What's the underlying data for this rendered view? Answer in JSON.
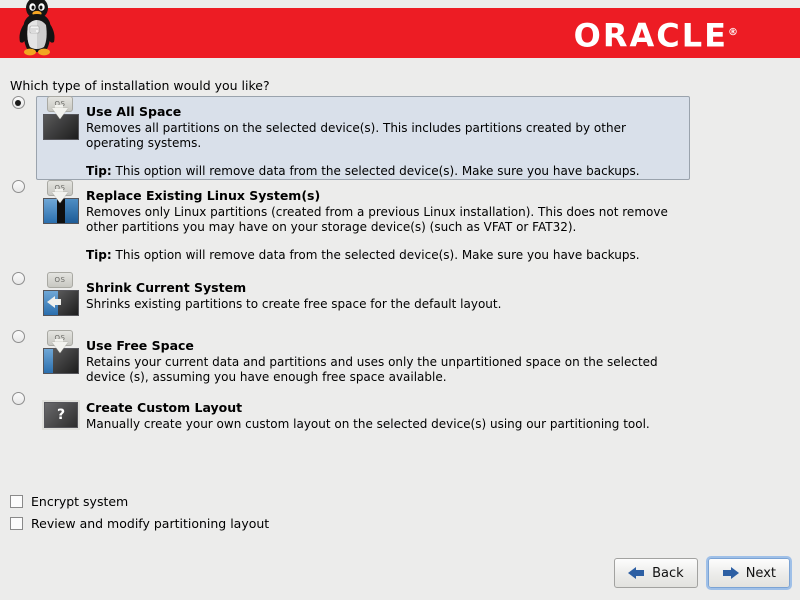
{
  "header": {
    "brand": "ORACLE",
    "registered_mark": "®",
    "logo_icon": "tux-penguin-icon",
    "background_color": "#ed1c24"
  },
  "main": {
    "question": "Which type of installation would you like?",
    "options": [
      {
        "id": "use-all-space",
        "title": "Use All Space",
        "description": "Removes all partitions on the selected device(s).  This includes partitions created by other operating systems.",
        "tip_label": "Tip:",
        "tip": " This option will remove data from the selected device(s).  Make sure you have backups.",
        "selected": true,
        "icon": "disk-erase-all-icon"
      },
      {
        "id": "replace-existing-linux",
        "title": "Replace Existing Linux System(s)",
        "description": "Removes only Linux partitions (created from a previous Linux installation).  This does not remove other partitions you may have on your storage device(s) (such as VFAT or FAT32).",
        "tip_label": "Tip:",
        "tip": " This option will remove data from the selected device(s).  Make sure you have backups.",
        "selected": false,
        "icon": "disk-replace-linux-icon"
      },
      {
        "id": "shrink-current-system",
        "title": "Shrink Current System",
        "description": "Shrinks existing partitions to create free space for the default layout.",
        "tip_label": "",
        "tip": "",
        "selected": false,
        "icon": "disk-shrink-icon"
      },
      {
        "id": "use-free-space",
        "title": "Use Free Space",
        "description": "Retains your current data and partitions and uses only the unpartitioned space on the selected device (s), assuming you have enough free space available.",
        "tip_label": "",
        "tip": "",
        "selected": false,
        "icon": "disk-free-space-icon"
      },
      {
        "id": "create-custom-layout",
        "title": "Create Custom Layout",
        "description": "Manually create your own custom layout on the selected device(s) using our partitioning tool.",
        "tip_label": "",
        "tip": "",
        "selected": false,
        "icon": "disk-custom-question-icon"
      }
    ],
    "checkboxes": [
      {
        "id": "encrypt-system",
        "label": "Encrypt system",
        "checked": false
      },
      {
        "id": "review-modify-partitioning",
        "label": "Review and modify partitioning layout",
        "checked": false
      }
    ]
  },
  "footer": {
    "back_label": "Back",
    "next_label": "Next",
    "back_icon": "arrow-left-icon",
    "next_icon": "arrow-right-icon",
    "focused_button": "next"
  },
  "colors": {
    "oracle_red": "#ed1c24",
    "page_background": "#ececeb",
    "selected_panel": "#d9e0ea",
    "selected_panel_border": "#9aa3ad",
    "accent_blue": "#2d5fa3"
  },
  "os_tag_text": "OS",
  "question_mark": "?"
}
